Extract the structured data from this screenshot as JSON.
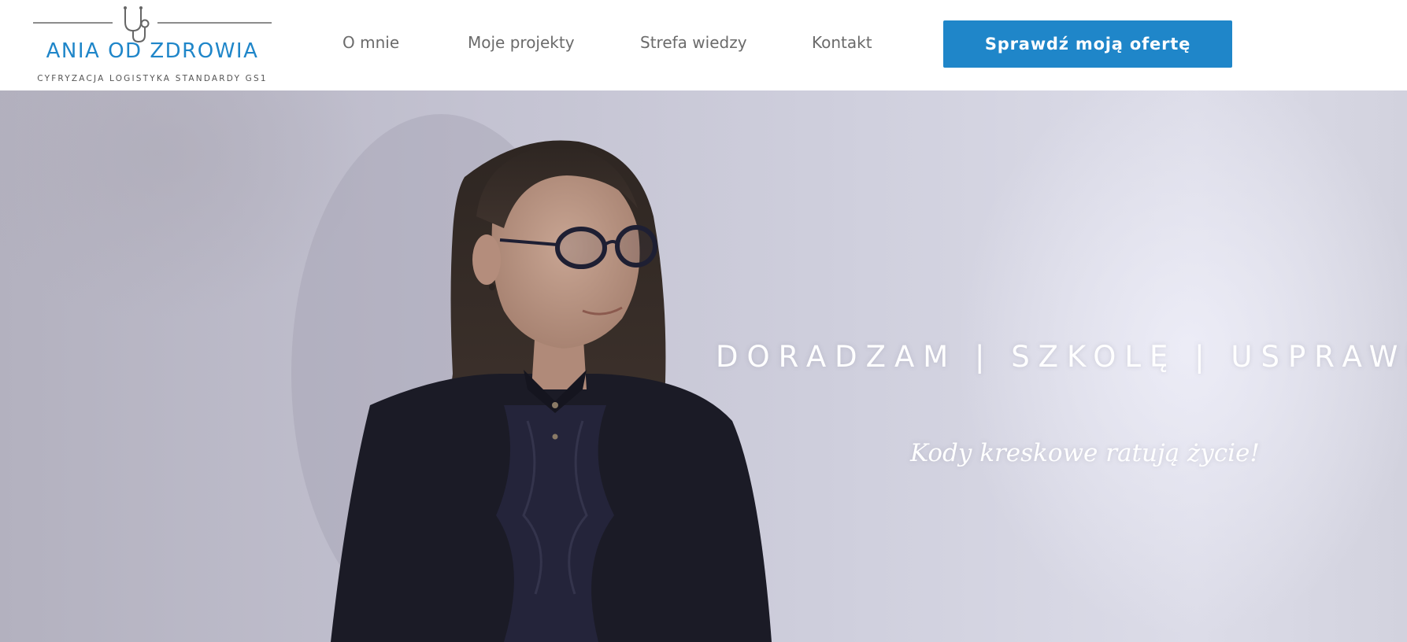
{
  "header": {
    "logo": {
      "title": "ANIA OD ZDROWIA",
      "tagline": "CYFRYZACJA   LOGISTYKA   STANDARDY GS1",
      "icon": "stethoscope-icon"
    },
    "nav": [
      {
        "label": "O mnie"
      },
      {
        "label": "Moje projekty"
      },
      {
        "label": "Strefa wiedzy"
      },
      {
        "label": "Kontakt"
      }
    ],
    "cta_label": "Sprawdź moją ofertę"
  },
  "hero": {
    "heading": "DORADZAM | SZKOLĘ | USPRAWNI",
    "subheading": "Kody kreskowe ratują życie!",
    "image": "portrait-photo"
  },
  "colors": {
    "brand_blue": "#1f86c9",
    "nav_text": "#6b6b6b",
    "hero_text": "#ffffff"
  }
}
